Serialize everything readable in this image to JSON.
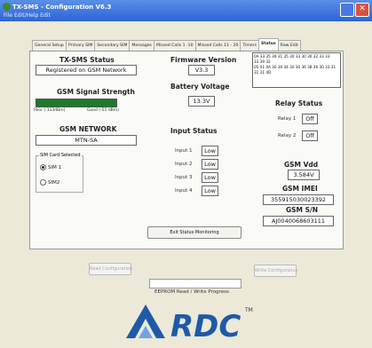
{
  "window": {
    "title": "TX-SMS - Configuration V6.3",
    "menu": "File   Edit/Help   Edit"
  },
  "tabs": [
    "General Setup",
    "Primary SIM",
    "Secondary SIM",
    "Messages",
    "Missed Calls 1 -10",
    "Missed Calls 11 - 20",
    "Timers",
    "Status",
    "Raw Edit"
  ],
  "status": {
    "tx_sms_title": "TX-SMS Status",
    "tx_sms_value": "Registered on GSM Network",
    "firmware_title": "Firmware Version",
    "firmware_value": "V3.3",
    "battery_title": "Battery Voltage",
    "battery_value": "13.3V",
    "hex_lines": [
      "0A 33 35 39 31 35 30 33 30 30 32 33 33",
      "33 39 32",
      "05 41 4A 30 30 34 30 30 36 38 36 30 33 31",
      "31 31 4D"
    ],
    "signal_title": "GSM Signal Strength",
    "signal_level": 1.0,
    "signal_poor": "Poor (-113dBm)",
    "signal_good": "Good (-51 dBm)",
    "relay_title": "Relay Status",
    "relay1_label": "Relay 1",
    "relay1_value": "Off",
    "relay2_label": "Relay 2",
    "relay2_value": "Off",
    "network_title": "GSM NETWORK",
    "network_value": "MTN-SA",
    "input_title": "Input Status",
    "inputs": [
      {
        "label": "Input 1",
        "value": "Low"
      },
      {
        "label": "Input 2",
        "value": "Low"
      },
      {
        "label": "Input 3",
        "value": "Low"
      },
      {
        "label": "Input 4",
        "value": "Low"
      }
    ],
    "sim_group_title": "SIM Card Selected",
    "sim1_label": "SIM 1",
    "sim2_label": "SIM2",
    "vdd_title": "GSM Vdd",
    "vdd_value": "3.584V",
    "imei_title": "GSM IMEI",
    "imei_value": "355915030023392",
    "sn_title": "GSM S/N",
    "sn_value": "AJ0040068603111",
    "exit_button": "Exit Status Monitoring"
  },
  "footer": {
    "read_button": "Read Configuration",
    "write_button": "Write Configuration",
    "progress_label": "EEPROM Read / Write Progress",
    "progress_fraction": 0.0
  },
  "logo": {
    "text": "RDC",
    "tm": "TM"
  },
  "colors": {
    "signal_bar": "#1d7a2a",
    "titlebar": "#2d63d6",
    "logo": "#1f5aa8"
  }
}
